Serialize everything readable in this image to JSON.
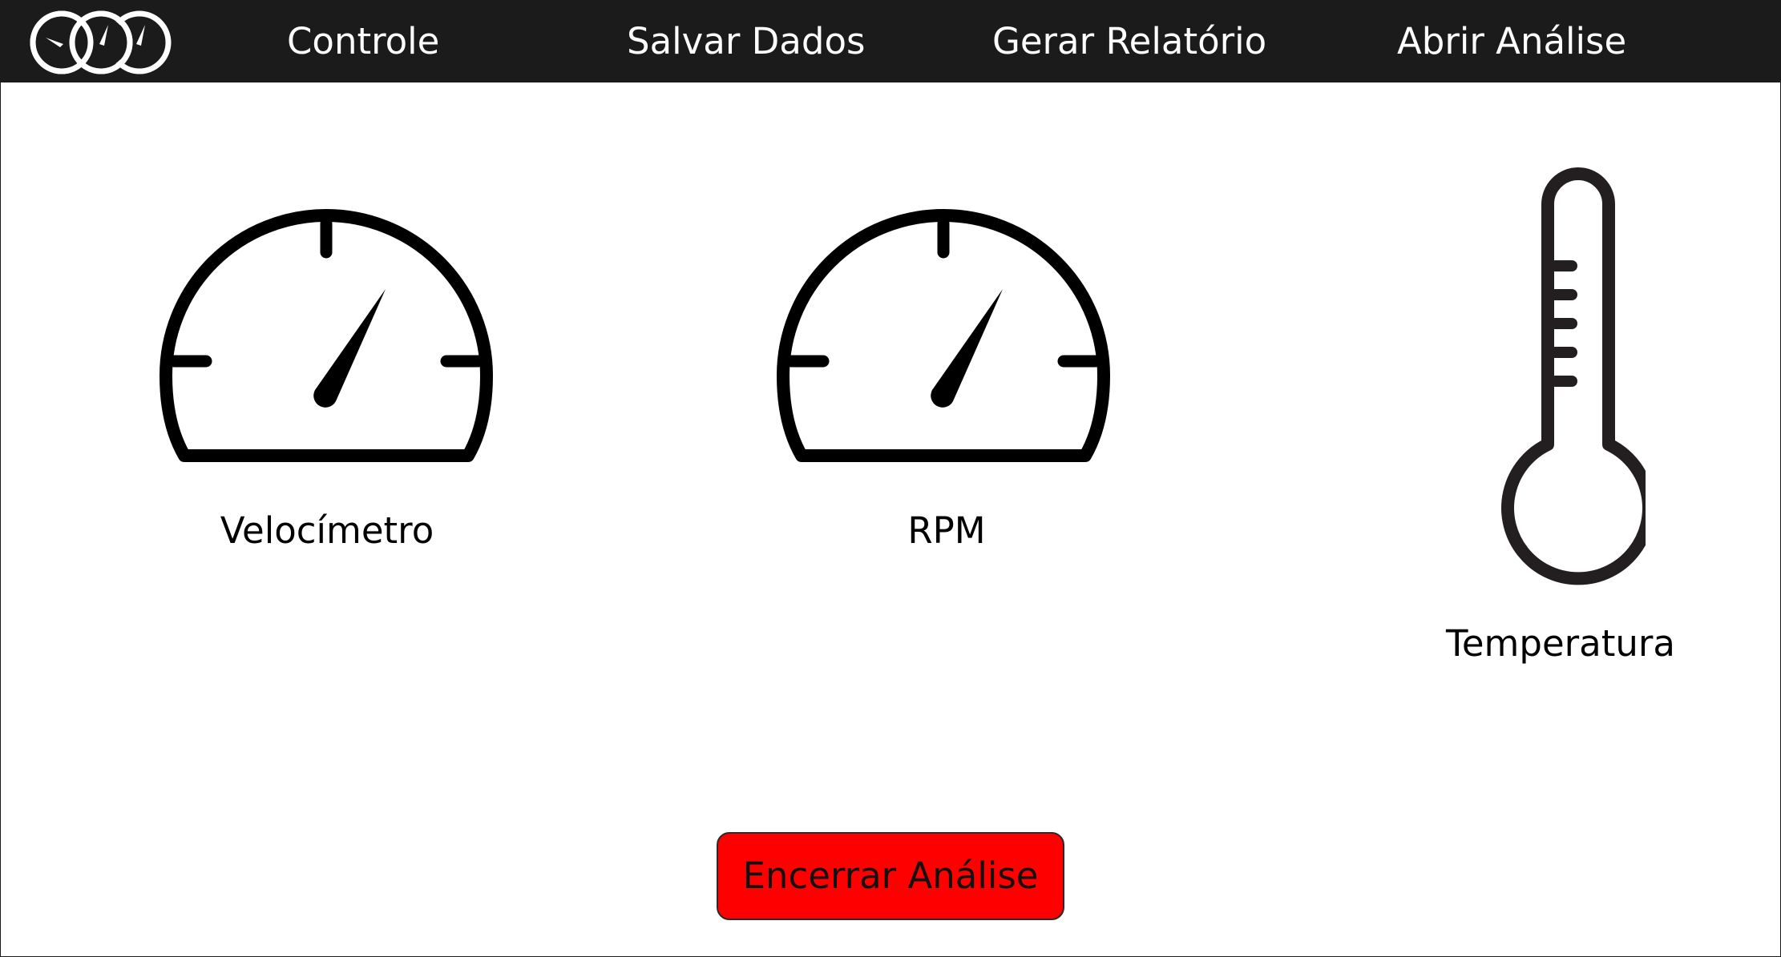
{
  "nav": {
    "logo_icon": "gauges-logo-icon",
    "items": [
      {
        "label": "Controle"
      },
      {
        "label": "Salvar Dados"
      },
      {
        "label": "Gerar Relatório"
      },
      {
        "label": "Abrir Análise"
      }
    ]
  },
  "instruments": {
    "speedometer": {
      "label": "Velocímetro",
      "icon": "speedometer-icon"
    },
    "rpm": {
      "label": "RPM",
      "icon": "rpm-gauge-icon"
    },
    "temperature": {
      "label": "Temperatura",
      "icon": "thermometer-icon"
    }
  },
  "actions": {
    "end_label": "Encerrar Análise"
  },
  "colors": {
    "topbar": "#1b1b1b",
    "end_button": "#ff0000"
  }
}
